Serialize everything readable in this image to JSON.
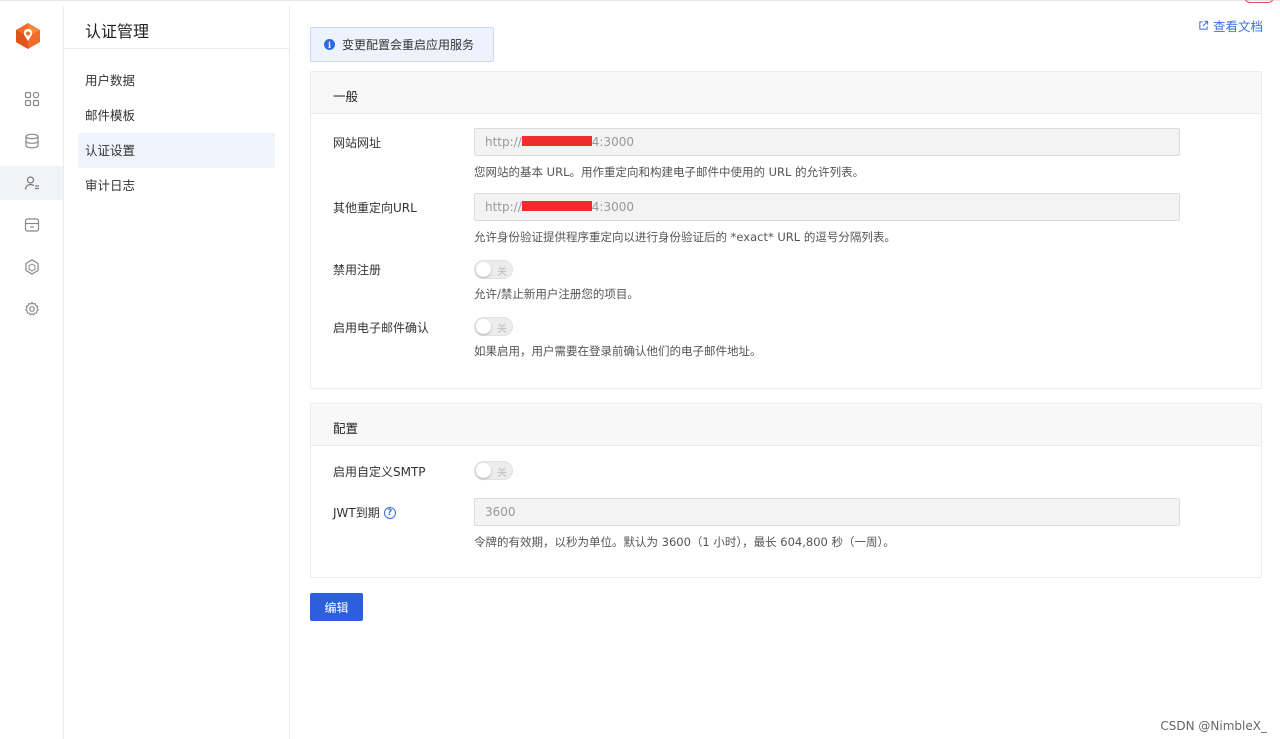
{
  "app": {
    "accent": "#2d5fdd",
    "rail_icons": [
      "logo-icon",
      "dashboard-icon",
      "database-icon",
      "user-auth-icon",
      "storage-icon",
      "edge-function-icon",
      "settings-icon"
    ]
  },
  "sidebar": {
    "title": "认证管理",
    "items": [
      {
        "label": "用户数据"
      },
      {
        "label": "邮件模板"
      },
      {
        "label": "认证设置"
      },
      {
        "label": "审计日志"
      }
    ],
    "active_index": 2
  },
  "header": {
    "docs_link": "查看文档"
  },
  "notice": {
    "text": "变更配置会重启应用服务"
  },
  "general": {
    "title": "一般",
    "site_url": {
      "label": "网站网址",
      "value_prefix": "http://",
      "value_suffix": "4:3000",
      "help": "您网站的基本 URL。用作重定向和构建电子邮件中使用的 URL 的允许列表。"
    },
    "redirect_urls": {
      "label": "其他重定向URL",
      "value_prefix": "http://",
      "value_suffix": "4:3000",
      "help": "允许身份验证提供程序重定向以进行身份验证后的 *exact* URL 的逗号分隔列表。"
    },
    "disable_signup": {
      "label": "禁用注册",
      "toggle_text": "关",
      "enabled": false,
      "help": "允许/禁止新用户注册您的项目。"
    },
    "email_confirm": {
      "label": "启用电子邮件确认",
      "toggle_text": "关",
      "enabled": false,
      "help": "如果启用，用户需要在登录前确认他们的电子邮件地址。"
    }
  },
  "config": {
    "title": "配置",
    "custom_smtp": {
      "label": "启用自定义SMTP",
      "toggle_text": "关",
      "enabled": false
    },
    "jwt_expiry": {
      "label": "JWT到期",
      "value": "3600",
      "help": "令牌的有效期，以秒为单位。默认为 3600（1 小时），最长 604,800 秒（一周）。"
    }
  },
  "actions": {
    "edit_label": "编辑"
  },
  "watermark": "CSDN @NimbleX_"
}
